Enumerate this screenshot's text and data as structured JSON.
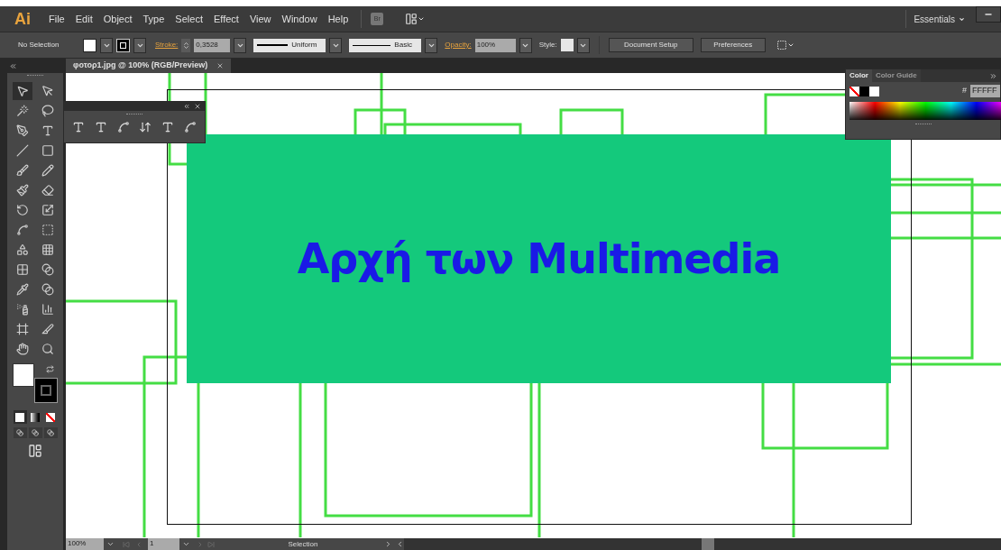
{
  "app": {
    "logo": "Ai",
    "menu": [
      "File",
      "Edit",
      "Object",
      "Type",
      "Select",
      "Effect",
      "View",
      "Window",
      "Help"
    ],
    "bridge": "Br",
    "workspace": "Essentials"
  },
  "control_bar": {
    "selection": "No Selection",
    "stroke_label": "Stroke:",
    "stroke_value": "0,3528",
    "profile": "Uniform",
    "brush": "Basic",
    "opacity_label": "Opacity:",
    "opacity_value": "100%",
    "style_label": "Style:",
    "buttons": [
      "Document Setup",
      "Preferences"
    ]
  },
  "document_tab": {
    "title": "φοτορ1.jpg @ 100% (RGB/Preview)"
  },
  "tools": [
    {
      "selected": true
    },
    {
      "selected": false
    },
    {
      "selected": false
    },
    {
      "selected": false
    },
    {
      "selected": false
    },
    {
      "selected": false
    },
    {
      "selected": false
    },
    {
      "selected": false
    },
    {
      "selected": false
    },
    {
      "selected": false
    },
    {
      "selected": false
    },
    {
      "selected": false
    },
    {
      "selected": false
    },
    {
      "selected": false
    },
    {
      "selected": false
    },
    {
      "selected": false
    },
    {
      "selected": false
    },
    {
      "selected": false
    },
    {
      "selected": false
    },
    {
      "selected": false
    },
    {
      "selected": false
    },
    {
      "selected": false
    },
    {
      "selected": false
    },
    {
      "selected": false
    },
    {
      "selected": false
    },
    {
      "selected": false
    },
    {
      "selected": false
    },
    {
      "selected": false
    }
  ],
  "color_panel": {
    "tabs": [
      {
        "label": "Color",
        "selected": true
      },
      {
        "label": "Color Guide",
        "selected": false
      }
    ],
    "hex_label": "#",
    "hex_value": "FFFFF"
  },
  "artwork": {
    "heading": "Αρχή των Multimedia"
  },
  "status_bar": {
    "zoom": "100%",
    "page": "1",
    "tool": "Selection"
  }
}
